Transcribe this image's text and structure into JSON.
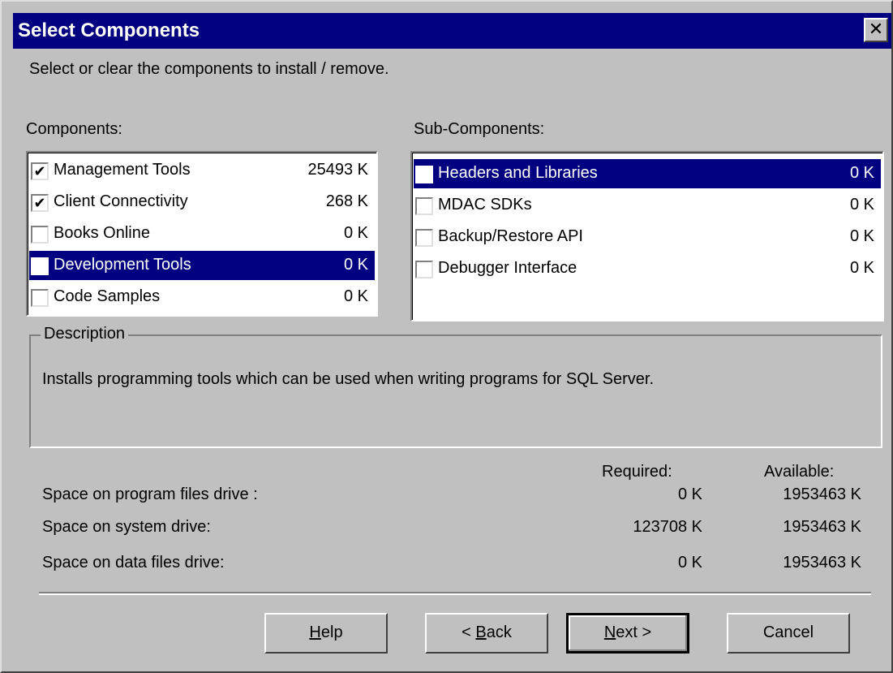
{
  "window": {
    "title": "Select Components",
    "close_glyph": "✕"
  },
  "instruction": "Select or clear the components to install / remove.",
  "components": {
    "label": "Components:",
    "items": [
      {
        "name": "Management Tools",
        "size": "25493 K",
        "checked": true,
        "selected": false
      },
      {
        "name": "Client Connectivity",
        "size": "268 K",
        "checked": true,
        "selected": false
      },
      {
        "name": "Books Online",
        "size": "0 K",
        "checked": false,
        "selected": false
      },
      {
        "name": "Development Tools",
        "size": "0 K",
        "checked": false,
        "selected": true
      },
      {
        "name": "Code Samples",
        "size": "0 K",
        "checked": false,
        "selected": false
      }
    ]
  },
  "subcomponents": {
    "label": "Sub-Components:",
    "items": [
      {
        "name": "Headers and Libraries",
        "size": "0 K",
        "checked": false,
        "selected": true
      },
      {
        "name": "MDAC SDKs",
        "size": "0 K",
        "checked": false,
        "selected": false
      },
      {
        "name": "Backup/Restore API",
        "size": "0 K",
        "checked": false,
        "selected": false
      },
      {
        "name": "Debugger Interface",
        "size": "0 K",
        "checked": false,
        "selected": false
      }
    ]
  },
  "description": {
    "legend": "Description",
    "text": "Installs programming tools which can be used when writing programs for SQL Server."
  },
  "space": {
    "required_header": "Required:",
    "available_header": "Available:",
    "rows": [
      {
        "label": "Space on program files drive :",
        "required": "0 K",
        "available": "1953463 K"
      },
      {
        "label": "Space on system drive:",
        "required": "123708 K",
        "available": "1953463 K"
      },
      {
        "label": "Space on data files drive:",
        "required": "0 K",
        "available": "1953463 K"
      }
    ]
  },
  "buttons": {
    "help": {
      "mnemonic": "H",
      "rest": "elp"
    },
    "back": {
      "prefix": "< ",
      "mnemonic": "B",
      "rest": "ack"
    },
    "next": {
      "mnemonic": "N",
      "rest": "ext >"
    },
    "cancel": {
      "label": "Cancel"
    }
  },
  "check_glyph": "✔"
}
